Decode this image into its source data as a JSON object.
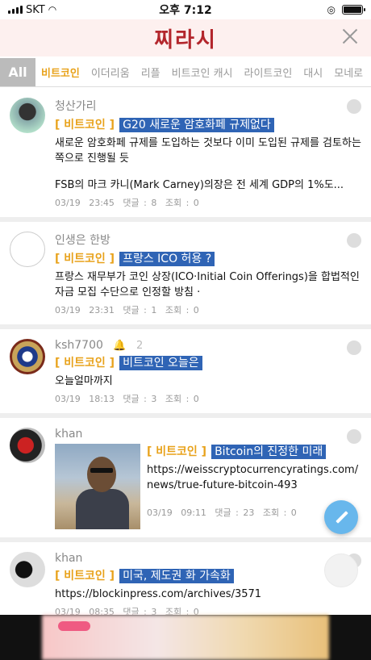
{
  "status_bar": {
    "carrier": "SKT",
    "time": "오후 7:12"
  },
  "header": {
    "title": "찌라시"
  },
  "tabs": {
    "all_label": "All",
    "items": [
      "비트코인",
      "이더리움",
      "리플",
      "비트코인 캐시",
      "라이트코인",
      "대시",
      "모네로"
    ]
  },
  "posts": [
    {
      "author": "청산가리",
      "category": "[ 비트코인 ]",
      "title": "G20 새로운 암호화페 규제없다",
      "body": "새로운 암호화페 규제를 도입하는 것보다 이미 도입된 규제를 검토하는 쪽으로 진행될 듯",
      "body2": "FSB의 마크 카니(Mark Carney)의장은 전 세계 GDP의 1%도...",
      "date": "03/19",
      "time": "23:45",
      "comments": "댓글 : 8",
      "views": "조회 : 0"
    },
    {
      "author": "인생은 한방",
      "category": "[ 비트코인 ]",
      "title": "프랑스 ICO 허용 ?",
      "body": "프랑스 재무부가 코인 상장(ICO·Initial Coin Offerings)을 합법적인 자금 모집 수단으로 인정할 방침 ·",
      "date": "03/19",
      "time": "23:31",
      "comments": "댓글 : 1",
      "views": "조회 : 0"
    },
    {
      "author": "ksh7700",
      "alert_count": "2",
      "category": "[ 비트코인 ]",
      "title": "비트코인 오늘은",
      "body": "오늘얼마까지",
      "date": "03/19",
      "time": "18:13",
      "comments": "댓글 : 3",
      "views": "조회 : 0"
    },
    {
      "author": "khan",
      "category": "[ 비트코인 ]",
      "title": "Bitcoin의 진정한 미래",
      "body": "https://weisscryptocurrencyratings.com/news/true-future-bitcoin-493",
      "date": "03/19",
      "time": "09:11",
      "comments": "댓글 : 23",
      "views": "조회 : 0"
    },
    {
      "author": "khan",
      "category": "[ 비트코인 ]",
      "title": "미국, 제도권 화 가속화",
      "body": "https://blockinpress.com/archives/3571",
      "date": "03/19",
      "time": "08:35",
      "comments": "댓글 : 3",
      "views": "조회 : 0"
    }
  ],
  "icons": {
    "close": "close-icon",
    "like": "thumbs-up-icon",
    "compose": "pencil-icon",
    "alert": "bell-icon"
  }
}
